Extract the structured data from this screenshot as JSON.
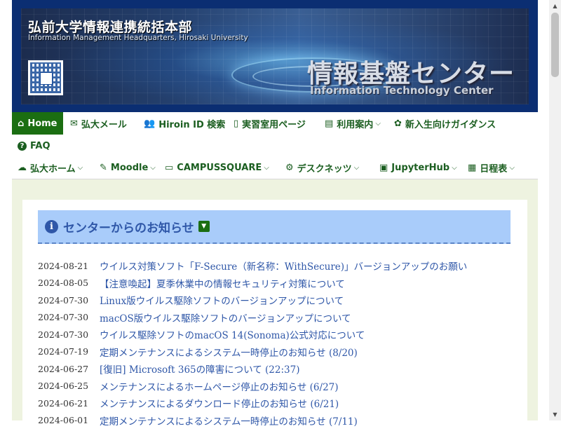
{
  "banner": {
    "title_jp": "弘前大学情報連携統括本部",
    "title_en": "Information Management Headquarters, Hirosaki University",
    "center_jp": "情報基盤センター",
    "center_en": "Information Technology Center",
    "qr_icon": "qr-code-icon"
  },
  "nav_primary": [
    {
      "label": "Home",
      "icon": "home-icon",
      "glyph": "⌂",
      "active": true
    },
    {
      "label": "弘大メール",
      "icon": "envelope-icon",
      "glyph": "✉"
    },
    {
      "label": "Hiroin ID 検索",
      "icon": "users-icon",
      "glyph": "👥"
    },
    {
      "label": "実習室用ページ",
      "icon": "mouse-icon",
      "glyph": "▯"
    },
    {
      "label": "利用案内",
      "icon": "document-icon",
      "glyph": "▤",
      "dropdown": true
    },
    {
      "label": "新入生向けガイダンス",
      "icon": "seedling-icon",
      "glyph": "✿"
    },
    {
      "label": "FAQ",
      "icon": "question-icon",
      "glyph": "?"
    }
  ],
  "nav_secondary": [
    {
      "label": "弘大ホーム",
      "icon": "cloud-icon",
      "glyph": "☁",
      "dropdown": true
    },
    {
      "label": "Moodle",
      "icon": "file-signature-icon",
      "glyph": "✎",
      "dropdown": true
    },
    {
      "label": "CAMPUSSQUARE",
      "icon": "laptop-icon",
      "glyph": "▭",
      "dropdown": true
    },
    {
      "label": "デスクネッツ",
      "icon": "user-gear-icon",
      "glyph": "⚙",
      "dropdown": true
    },
    {
      "label": "JupyterHub",
      "icon": "terminal-icon",
      "glyph": "▣",
      "dropdown": true
    },
    {
      "label": "日程表",
      "icon": "calendar-icon",
      "glyph": "▦",
      "dropdown": true
    }
  ],
  "news": {
    "title": "センターからのお知らせ",
    "info_glyph": "i",
    "rss_glyph": "▼",
    "items": [
      {
        "date": "2024-08-21",
        "title": "ウイルス対策ソフト「F-Secure（新名称：WithSecure)」バージョンアップのお願い"
      },
      {
        "date": "2024-08-05",
        "title": "【注意喚起】夏季休業中の情報セキュリティ対策について"
      },
      {
        "date": "2024-07-30",
        "title": "Linux版ウイルス駆除ソフトのバージョンアップについて"
      },
      {
        "date": "2024-07-30",
        "title": "macOS版ウイルス駆除ソフトのバージョンアップについて"
      },
      {
        "date": "2024-07-30",
        "title": "ウイルス駆除ソフトのmacOS 14(Sonoma)公式対応について"
      },
      {
        "date": "2024-07-19",
        "title": "定期メンテナンスによるシステム一時停止のお知らせ (8/20)"
      },
      {
        "date": "2024-06-27",
        "title": "[復旧] Microsoft 365の障害について (22:37)"
      },
      {
        "date": "2024-06-25",
        "title": "メンテナンスによるホームページ停止のお知らせ (6/27)"
      },
      {
        "date": "2024-06-21",
        "title": "メンテナンスによるダウンロード停止のお知らせ (6/21)"
      },
      {
        "date": "2024-06-01",
        "title": "定期メンテナンスによるシステム一時停止のお知らせ (7/11)"
      }
    ]
  },
  "scrollbar": {
    "up_glyph": "▲",
    "down_glyph": "▼"
  }
}
